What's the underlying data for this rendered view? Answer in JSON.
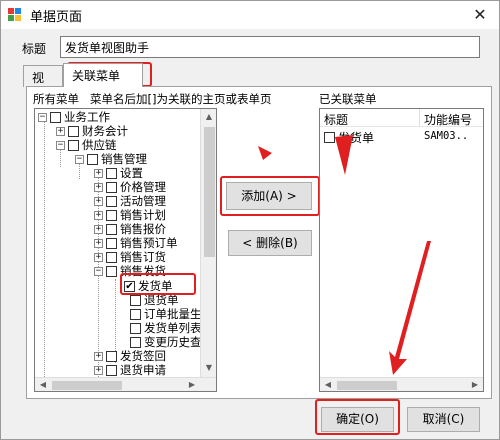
{
  "window": {
    "title": "单据页面"
  },
  "form": {
    "title_label": "标题",
    "title_value": "发货单视图助手"
  },
  "tabs": [
    {
      "label": "视图",
      "active": false
    },
    {
      "label": "关联菜单",
      "active": true
    }
  ],
  "left_panel": {
    "heading": "所有菜单   菜单名后加[]为关联的主页或表单页",
    "tree": [
      {
        "toggle": "−",
        "checked": false,
        "label": "业务工作"
      },
      {
        "toggle": "+",
        "checked": false,
        "label": "财务会计"
      },
      {
        "toggle": "−",
        "checked": false,
        "label": "供应链"
      },
      {
        "toggle": "−",
        "checked": false,
        "label": "销售管理"
      },
      {
        "toggle": "+",
        "checked": false,
        "label": "设置"
      },
      {
        "toggle": "+",
        "checked": false,
        "label": "价格管理"
      },
      {
        "toggle": "+",
        "checked": false,
        "label": "活动管理"
      },
      {
        "toggle": "+",
        "checked": false,
        "label": "销售计划"
      },
      {
        "toggle": "+",
        "checked": false,
        "label": "销售报价"
      },
      {
        "toggle": "+",
        "checked": false,
        "label": "销售预订单"
      },
      {
        "toggle": "+",
        "checked": false,
        "label": "销售订货"
      },
      {
        "toggle": "−",
        "checked": false,
        "label": "销售发货"
      },
      {
        "toggle": "",
        "checked": true,
        "label": "发货单"
      },
      {
        "toggle": "",
        "checked": false,
        "label": "退货单"
      },
      {
        "toggle": "",
        "checked": false,
        "label": "订单批量生"
      },
      {
        "toggle": "",
        "checked": false,
        "label": "发货单列表"
      },
      {
        "toggle": "",
        "checked": false,
        "label": "变更历史查"
      },
      {
        "toggle": "+",
        "checked": false,
        "label": "发货签回"
      },
      {
        "toggle": "+",
        "checked": false,
        "label": "退货申请"
      }
    ]
  },
  "buttons": {
    "add": "添加(A) >",
    "delete": "< 删除(B)",
    "ok": "确定(O)",
    "cancel": "取消(C)"
  },
  "right_panel": {
    "heading": "已关联菜单",
    "columns": [
      "标题",
      "功能编号"
    ],
    "rows": [
      {
        "checked": false,
        "title": "发货单",
        "code": "SAM03.."
      }
    ]
  },
  "colors": {
    "annotation": "#e02020",
    "window_bg": "#f0f0f0"
  }
}
